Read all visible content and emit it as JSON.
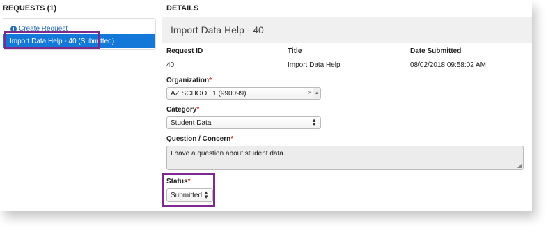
{
  "requests": {
    "header": "REQUESTS (1)",
    "create_link": "Create Request",
    "items": [
      {
        "label": "Import Data Help - 40 (Submitted)"
      }
    ]
  },
  "details": {
    "header": "DETAILS",
    "title": "Import Data Help - 40",
    "columns": {
      "request_id_label": "Request ID",
      "title_label": "Title",
      "date_label": "Date Submitted",
      "request_id_value": "40",
      "title_value": "Import Data Help",
      "date_value": "08/02/2018 09:58:02 AM"
    },
    "organization": {
      "label": "Organization",
      "required": "*",
      "value": "AZ SCHOOL 1 (990099)",
      "clear": "×"
    },
    "category": {
      "label": "Category",
      "required": "*",
      "value": "Student Data"
    },
    "question": {
      "label": "Question / Concern",
      "required": "*",
      "value": "I have a question about student data."
    },
    "status": {
      "label": "Status",
      "required": "*",
      "value": "Submitted"
    }
  },
  "colors": {
    "highlight": "#7d2a8c",
    "selected_item": "#1478d8",
    "link": "#2a6db0",
    "required": "#c0392b"
  },
  "icons": {
    "create": "plus-circle-icon",
    "dropdown": "chevron-updown-icon",
    "clear": "clear-x-icon",
    "resize": "resize-handle-icon"
  }
}
